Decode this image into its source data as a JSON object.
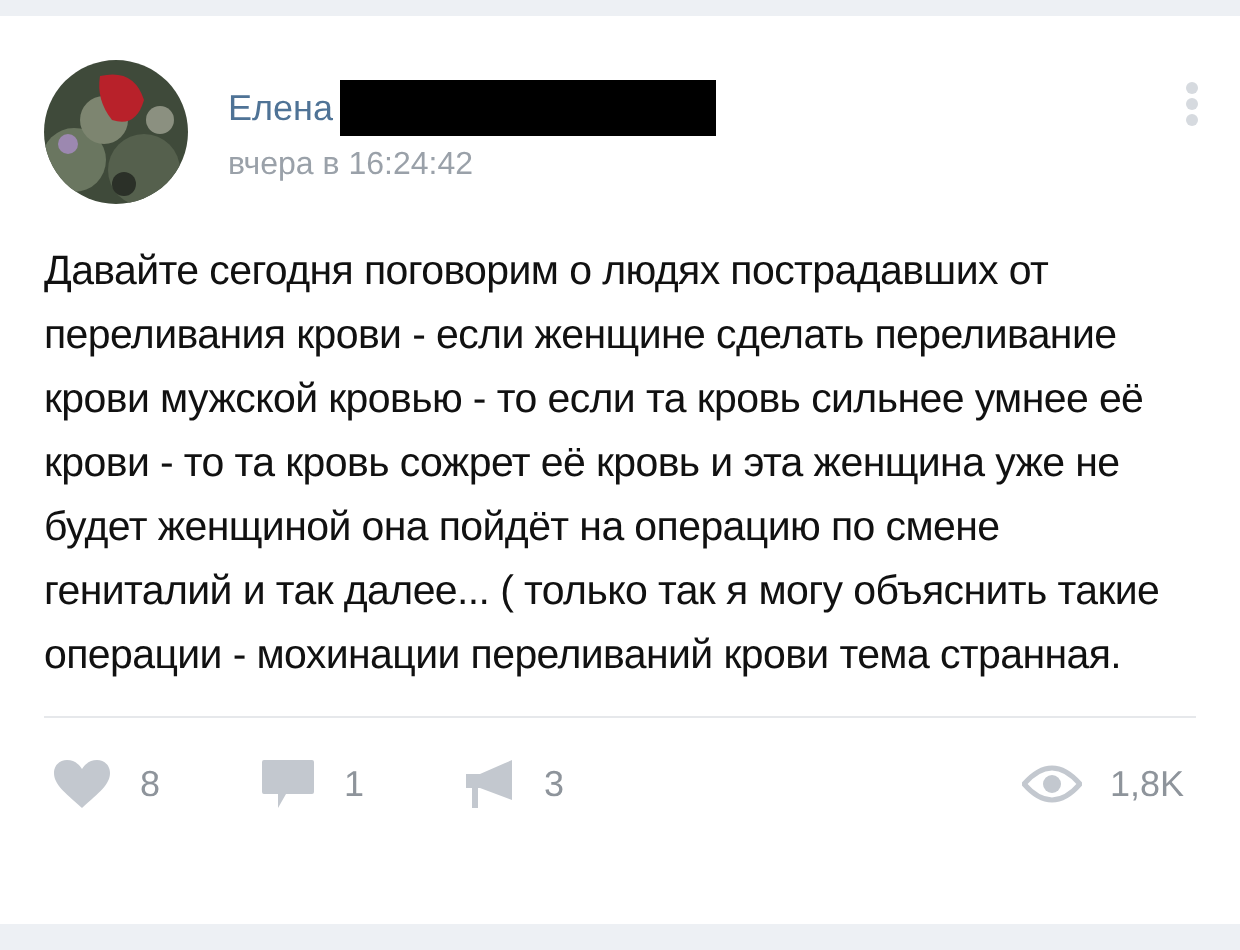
{
  "post": {
    "author": "Елена",
    "author_redacted": true,
    "time": "вчера в 16:24:42",
    "text": "Давайте сегодня поговорим о людях пострадавших от переливания крови - если женщине сделать переливание крови мужской кровью - то если та кровь сильнее умнее её крови - то та кровь сожрет её кровь и эта женщина уже не будет женщиной она пойдёт на операцию по смене гениталий и так далее... ( только так я могу объяснить такие операции - мохинации переливаний крови тема странная."
  },
  "actions": [
    {
      "kind": "like",
      "count": "8"
    },
    {
      "kind": "comment",
      "count": "1"
    },
    {
      "kind": "share",
      "count": "3"
    },
    {
      "kind": "views",
      "count": "1,8K"
    }
  ]
}
